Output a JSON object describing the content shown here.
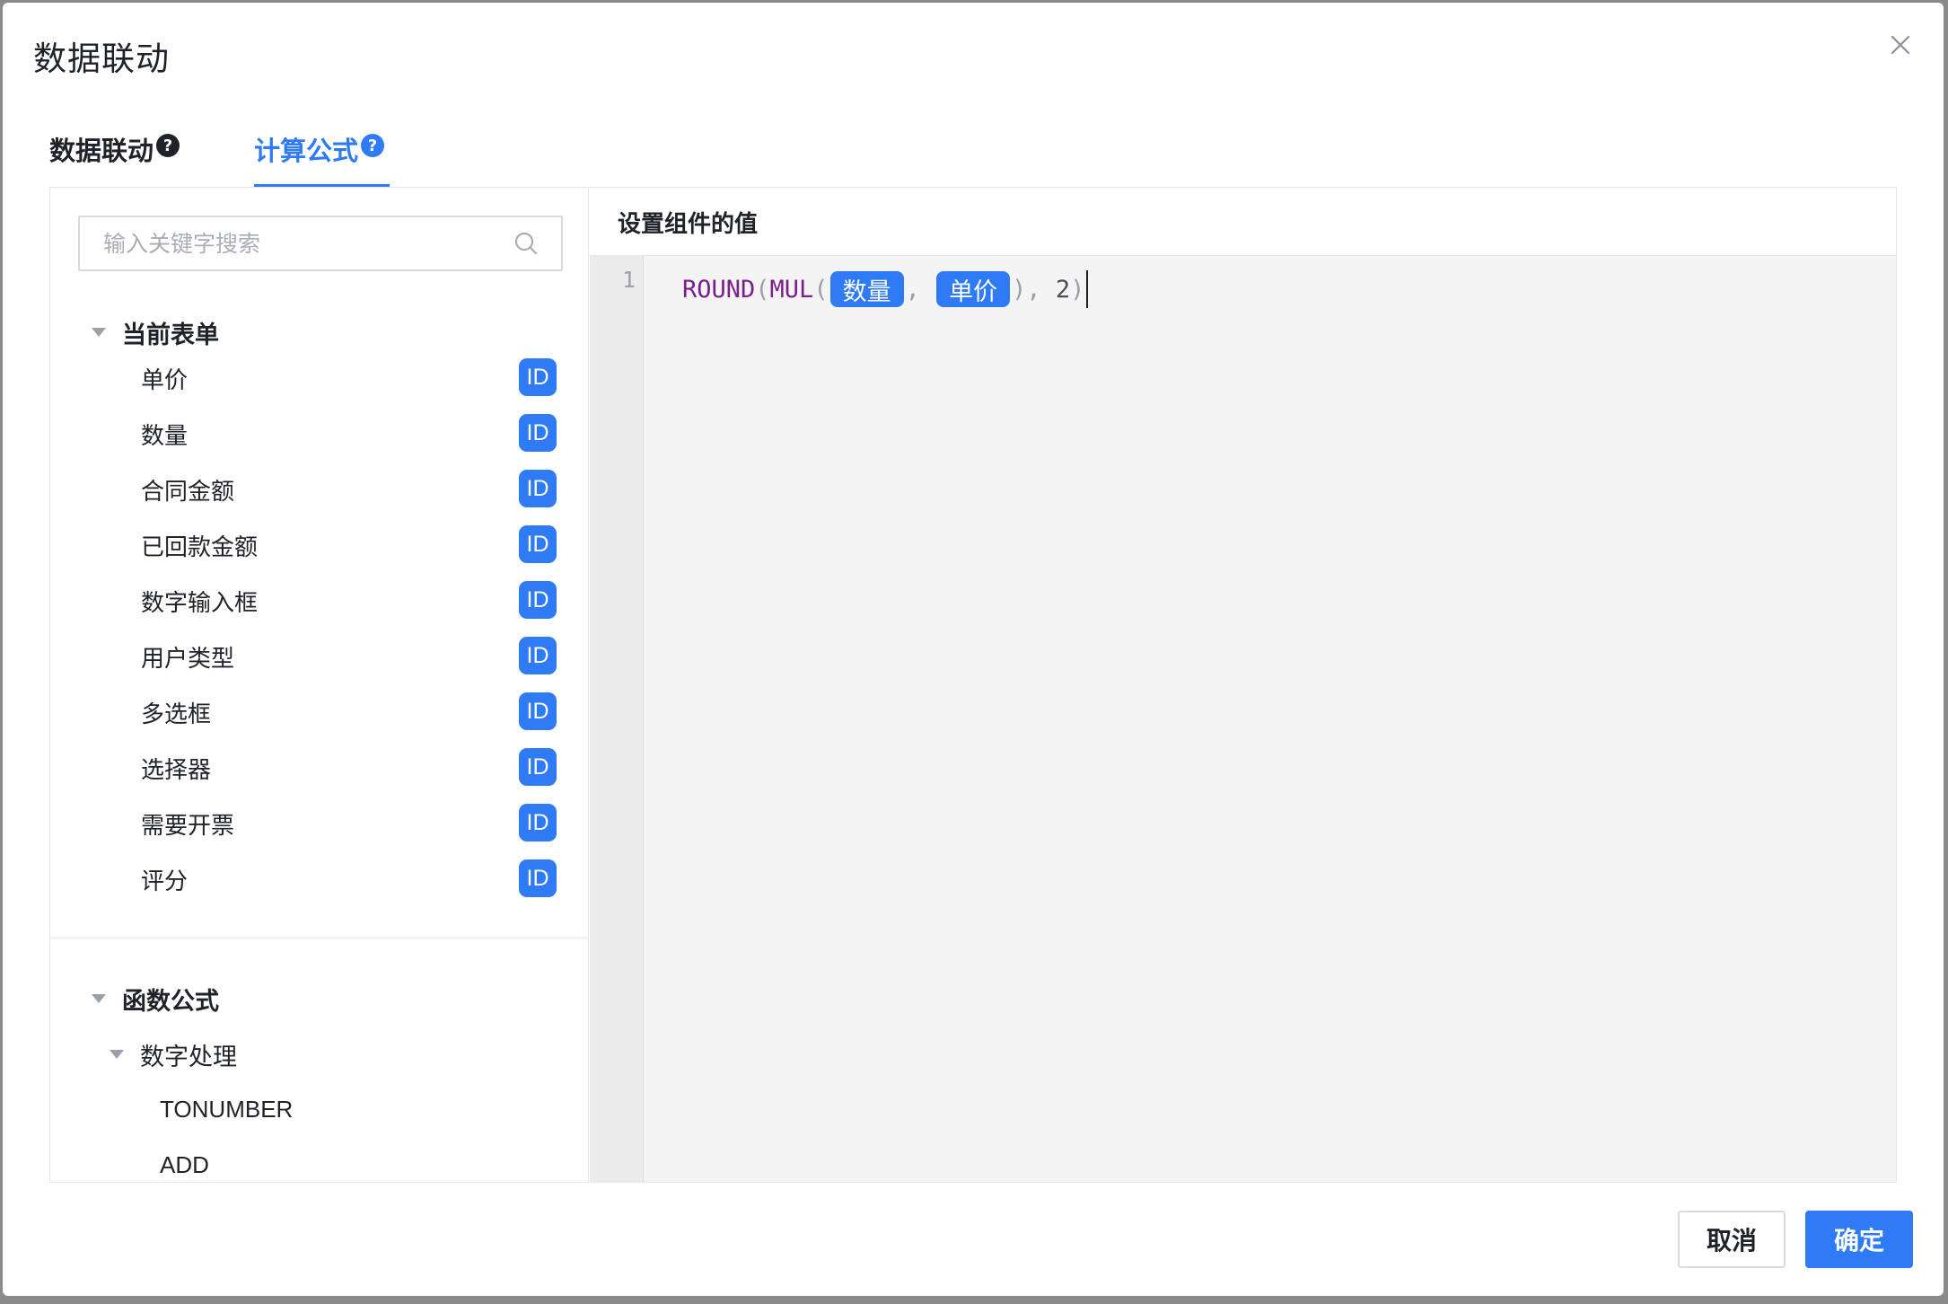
{
  "dialog": {
    "title": "数据联动",
    "close_icon": "close-icon"
  },
  "tabs": [
    {
      "label": "数据联动",
      "help_icon": "question-circle-icon",
      "active": false
    },
    {
      "label": "计算公式",
      "help_icon": "question-circle-icon",
      "active": true
    }
  ],
  "search": {
    "placeholder": "输入关键字搜索",
    "value": "",
    "icon": "search-icon"
  },
  "current_form": {
    "label": "当前表单",
    "expanded": true,
    "fields": [
      {
        "label": "单价",
        "badge": "ID"
      },
      {
        "label": "数量",
        "badge": "ID"
      },
      {
        "label": "合同金额",
        "badge": "ID"
      },
      {
        "label": "已回款金额",
        "badge": "ID"
      },
      {
        "label": "数字输入框",
        "badge": "ID"
      },
      {
        "label": "用户类型",
        "badge": "ID"
      },
      {
        "label": "多选框",
        "badge": "ID"
      },
      {
        "label": "选择器",
        "badge": "ID"
      },
      {
        "label": "需要开票",
        "badge": "ID"
      },
      {
        "label": "评分",
        "badge": "ID"
      }
    ]
  },
  "functions": {
    "label": "函数公式",
    "expanded": true,
    "groups": [
      {
        "label": "数字处理",
        "expanded": true,
        "items": [
          "TONUMBER",
          "ADD"
        ]
      }
    ]
  },
  "editor": {
    "header": "设置组件的值",
    "line_number": "1",
    "tokens": {
      "fn_round": "ROUND",
      "paren_open_1": "(",
      "fn_mul": "MUL",
      "paren_open_2": "(",
      "field_1": "数量",
      "comma_1": ", ",
      "field_2": "单价",
      "paren_close_1": ")",
      "comma_2": ", ",
      "number": "2",
      "paren_close_2": ")"
    }
  },
  "footer": {
    "cancel_label": "取消",
    "ok_label": "确定"
  },
  "colors": {
    "accent": "#2f7bf5",
    "function_token": "#7a1f8c",
    "text": "#1f2329"
  }
}
